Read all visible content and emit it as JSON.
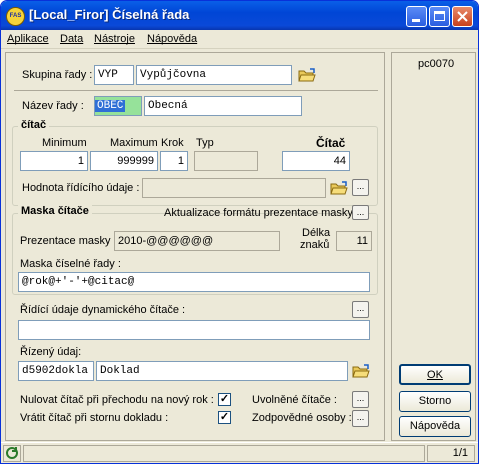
{
  "window": {
    "app_logo": "FAS",
    "title": "[Local_Firor] Číselná řada"
  },
  "menu": [
    "Aplikace",
    "Data",
    "Nástroje",
    "Nápověda"
  ],
  "form_code": "pc0070",
  "group_row": {
    "label": "Skupina řady :",
    "code": "VYP",
    "name": "Vypůjčovna"
  },
  "series_name": {
    "label": "Název řady :",
    "code": "OBEC",
    "name": "Obecná"
  },
  "counter": {
    "title": "čítač",
    "minimum_label": "Minimum",
    "maximum_label": "Maximum",
    "step_label": "Krok",
    "type_label": "Typ",
    "counter_label": "Čítač",
    "minimum": "1",
    "maximum": "999999",
    "step": "1",
    "type": "",
    "counter_value": "44",
    "control_value_label": "Hodnota řídícího údaje :",
    "control_value": ""
  },
  "mask": {
    "title": "Maska čítače",
    "update_label": "Aktualizace formátu prezentace masky",
    "presentation_label": "Prezentace masky :",
    "presentation_value": "2010-@@@@@@",
    "length_label_1": "Délka",
    "length_label_2": "znaků",
    "length_value": "11",
    "series_mask_label": "Maska číselné řady :",
    "series_mask_value": "@rok@+'-'+@citac@",
    "dynamic_label": "Řídící údaje dynamického čítače :",
    "dynamic_value": "",
    "controlled_label": "Řízený údaj:",
    "controlled_code": "d5902dokla",
    "controlled_name": "Doklad"
  },
  "options": {
    "new_year_label": "Nulovat čítač při přechodu na nový rok :",
    "new_year_checked": true,
    "storno_label": "Vrátit čítač při stornu dokladu :",
    "storno_checked": true,
    "released_label": "Uvolněné čítače :",
    "responsible_label": "Zodpovědné osoby :"
  },
  "buttons": {
    "ok": "OK",
    "storno": "Storno",
    "help": "Nápověda"
  },
  "status": {
    "page": "1/1"
  },
  "colors": {
    "code_highlight": "#2f6fd6",
    "code_text": "#ffffff",
    "code_green": "#96e29a"
  }
}
